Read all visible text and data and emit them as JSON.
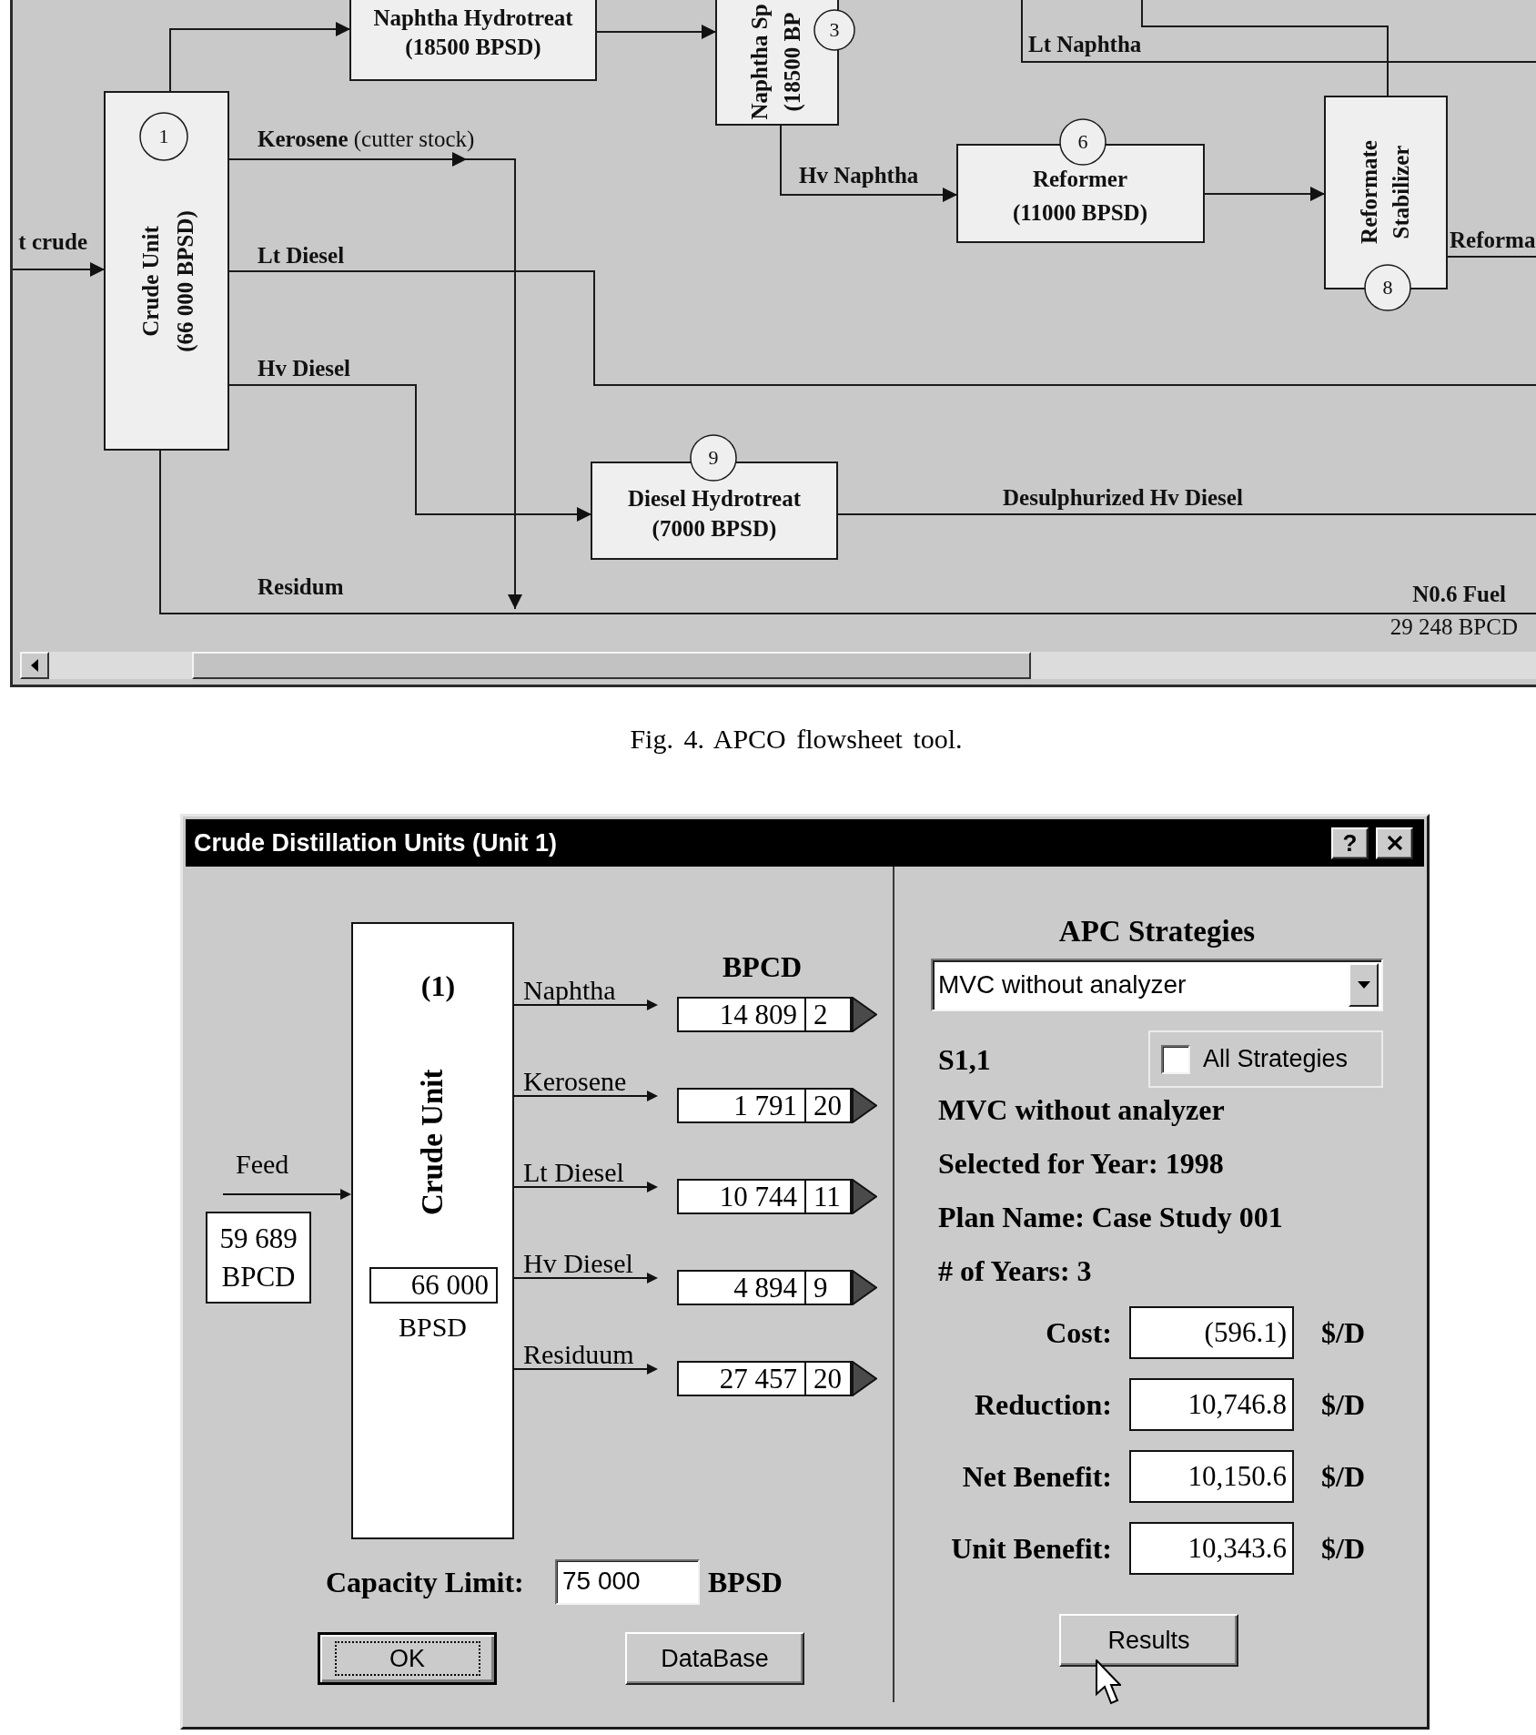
{
  "flowsheet": {
    "units": [
      {
        "kind": "horizontal",
        "lines": [
          "Naphtha Hydrotreat",
          "(18500 BPSD)"
        ]
      },
      {
        "kind": "vertical",
        "lines": [
          "Naphtha Sp",
          "(18500 BP"
        ],
        "number": "3"
      },
      {
        "kind": "vertical",
        "lines": [
          "Crude Unit",
          "(66 000 BPSD)"
        ],
        "number": "1"
      },
      {
        "kind": "horizontal",
        "lines": [
          "Reformer",
          "(11000 BPSD)"
        ],
        "number": "6"
      },
      {
        "kind": "vertical",
        "lines": [
          "Reformate",
          "Stabilizer"
        ],
        "number": "8"
      },
      {
        "kind": "horizontal",
        "lines": [
          "Diesel Hydrotreat",
          "(7000 BPSD)"
        ],
        "number": "9"
      }
    ],
    "streams": [
      {
        "label": "t crude"
      },
      {
        "label": "Kerosene",
        "note": "(cutter stock)"
      },
      {
        "label": "Lt Diesel"
      },
      {
        "label": "Hv Diesel"
      },
      {
        "label": "Residum"
      },
      {
        "label": "Hv Naphtha"
      },
      {
        "label": "Lt Naphtha"
      },
      {
        "label": "Reforma"
      },
      {
        "label": "Desulphurized Hv Diesel"
      }
    ],
    "outputs": [
      {
        "name": "N0.6 Fuel",
        "flow": "29 248 BPCD"
      }
    ]
  },
  "caption": "Fig. 4. APCO flowsheet tool.",
  "dialog": {
    "title": "Crude Distillation Units (Unit 1)",
    "help_button": "?",
    "unit": {
      "number": "(1)",
      "name": "Crude Unit",
      "capacity": "66 000",
      "capacity_unit": "BPSD"
    },
    "feed": {
      "label": "Feed",
      "value": "59 689",
      "unit": "BPCD"
    },
    "products_heading": "BPCD",
    "products": [
      {
        "name": "Naphtha",
        "bpcd": "14 809",
        "column_2": "2"
      },
      {
        "name": "Kerosene",
        "bpcd": "1 791",
        "column_2": "20"
      },
      {
        "name": "Lt Diesel",
        "bpcd": "10 744",
        "column_2": "11"
      },
      {
        "name": "Hv Diesel",
        "bpcd": "4 894",
        "column_2": "9"
      },
      {
        "name": "Residuum",
        "bpcd": "27 457",
        "column_2": "20"
      }
    ],
    "capacity_limit": {
      "label": "Capacity Limit:",
      "value": "75 000",
      "unit": "BPSD"
    },
    "buttons": [
      {
        "label": "OK",
        "default": true
      },
      {
        "label": "DataBase",
        "default": false
      }
    ],
    "strategies": {
      "heading": "APC Strategies",
      "dropdown": "MVC without analyzer",
      "code": "S1,1",
      "all_strategies": {
        "label": "All Strategies",
        "checked": false
      },
      "details": [
        "MVC without analyzer",
        "Selected for Year: 1998",
        "Plan Name: Case Study 001",
        "# of Years: 3"
      ],
      "metrics": [
        {
          "label": "Cost:",
          "value": "(596.1)",
          "unit": "$/D"
        },
        {
          "label": "Reduction:",
          "value": "10,746.8",
          "unit": "$/D"
        },
        {
          "label": "Net Benefit:",
          "value": "10,150.6",
          "unit": "$/D"
        },
        {
          "label": "Unit Benefit:",
          "value": "10,343.6",
          "unit": "$/D"
        }
      ],
      "results_button": "Results"
    }
  }
}
